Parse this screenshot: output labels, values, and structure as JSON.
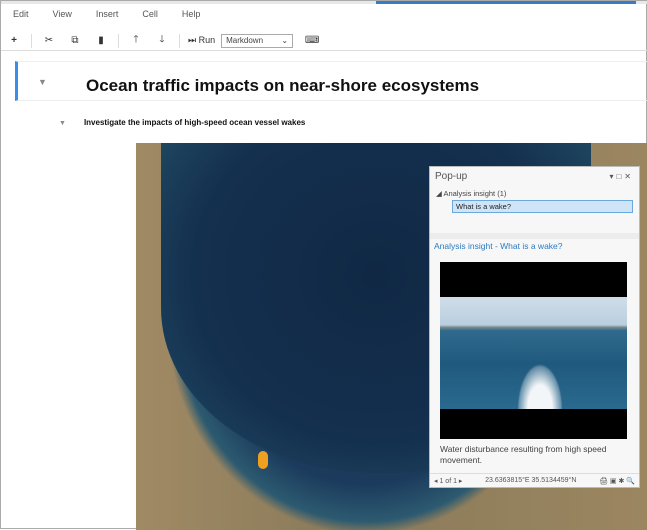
{
  "menu": [
    "Edit",
    "View",
    "Insert",
    "Cell",
    "Help"
  ],
  "toolbar": {
    "run_label": "Run",
    "cell_type": "Markdown"
  },
  "notebook": {
    "heading": "Ocean traffic impacts on near-shore ecosystems",
    "subheading": "Investigate the impacts of high-speed ocean vessel wakes"
  },
  "popup": {
    "title": "Pop-up",
    "group": "Analysis insight  (1)",
    "selected": "What is a wake?",
    "insight_title": "Analysis insight - What is a wake?",
    "description": "Water disturbance resulting from high speed movement.",
    "pager": "1 of 1",
    "coords": "23.6363815°E 35.5134459°N"
  }
}
